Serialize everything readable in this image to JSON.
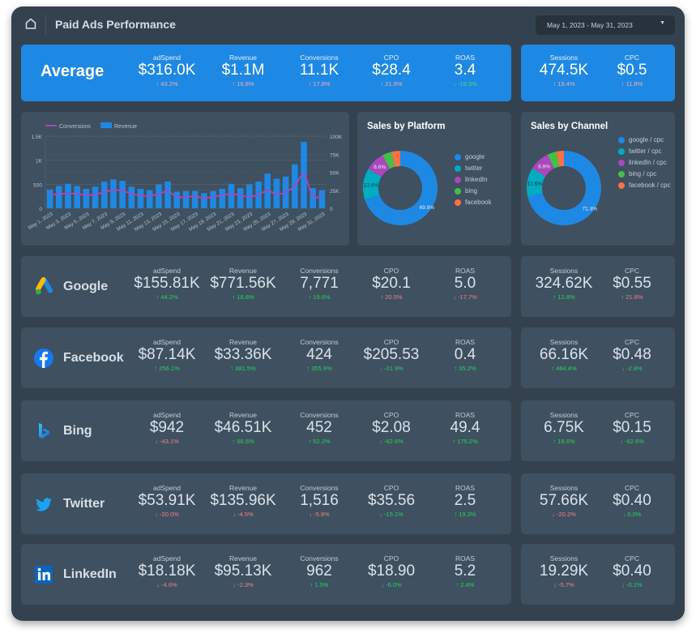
{
  "header": {
    "title": "Paid Ads Performance",
    "date_range": "May 1, 2023 - May 31, 2023",
    "home_icon": "home-icon",
    "dropdown_icon": "caret-down-icon"
  },
  "average": {
    "label": "Average",
    "metrics": [
      {
        "label": "adSpend",
        "value": "$316.0K",
        "change": "43.2%",
        "direction": "up",
        "sentiment": "bad"
      },
      {
        "label": "Revenue",
        "value": "$1.1M",
        "change": "16.8%",
        "direction": "up",
        "sentiment": "bad"
      },
      {
        "label": "Conversions",
        "value": "11.1K",
        "change": "17.8%",
        "direction": "up",
        "sentiment": "bad"
      },
      {
        "label": "CPO",
        "value": "$28.4",
        "change": "21.6%",
        "direction": "up",
        "sentiment": "bad"
      },
      {
        "label": "ROAS",
        "value": "3.4",
        "change": "-18.5%",
        "direction": "down",
        "sentiment": "good"
      }
    ],
    "side_metrics": [
      {
        "label": "Sessions",
        "value": "474.5K",
        "change": "19.4%",
        "direction": "up",
        "sentiment": "bad"
      },
      {
        "label": "CPC",
        "value": "$0.5",
        "change": "11.8%",
        "direction": "up",
        "sentiment": "bad"
      }
    ]
  },
  "platforms": [
    {
      "name": "Google",
      "icon": "google-ads-icon",
      "metrics": [
        {
          "label": "adSpend",
          "value": "$155.81K",
          "change": "44.2%",
          "direction": "up",
          "sentiment": "good"
        },
        {
          "label": "Revenue",
          "value": "$771.56K",
          "change": "18.6%",
          "direction": "up",
          "sentiment": "good"
        },
        {
          "label": "Conversions",
          "value": "7,771",
          "change": "19.6%",
          "direction": "up",
          "sentiment": "good"
        },
        {
          "label": "CPO",
          "value": "$20.1",
          "change": "20.5%",
          "direction": "up",
          "sentiment": "bad"
        },
        {
          "label": "ROAS",
          "value": "5.0",
          "change": "-17.7%",
          "direction": "down",
          "sentiment": "bad"
        }
      ],
      "side_metrics": [
        {
          "label": "Sessions",
          "value": "324.62K",
          "change": "12.8%",
          "direction": "up",
          "sentiment": "good"
        },
        {
          "label": "CPC",
          "value": "$0.55",
          "change": "21.8%",
          "direction": "up",
          "sentiment": "bad"
        }
      ]
    },
    {
      "name": "Facebook",
      "icon": "facebook-icon",
      "metrics": [
        {
          "label": "adSpend",
          "value": "$87.14K",
          "change": "256.1%",
          "direction": "up",
          "sentiment": "good"
        },
        {
          "label": "Revenue",
          "value": "$33.36K",
          "change": "381.5%",
          "direction": "up",
          "sentiment": "good"
        },
        {
          "label": "Conversions",
          "value": "424",
          "change": "355.9%",
          "direction": "up",
          "sentiment": "good"
        },
        {
          "label": "CPO",
          "value": "$205.53",
          "change": "-21.9%",
          "direction": "down",
          "sentiment": "good"
        },
        {
          "label": "ROAS",
          "value": "0.4",
          "change": "35.2%",
          "direction": "up",
          "sentiment": "good"
        }
      ],
      "side_metrics": [
        {
          "label": "Sessions",
          "value": "66.16K",
          "change": "484.4%",
          "direction": "up",
          "sentiment": "good"
        },
        {
          "label": "CPC",
          "value": "$0.48",
          "change": "-2.8%",
          "direction": "down",
          "sentiment": "good"
        }
      ]
    },
    {
      "name": "Bing",
      "icon": "bing-icon",
      "metrics": [
        {
          "label": "adSpend",
          "value": "$942",
          "change": "-43.1%",
          "direction": "down",
          "sentiment": "bad"
        },
        {
          "label": "Revenue",
          "value": "$46.51K",
          "change": "56.5%",
          "direction": "up",
          "sentiment": "good"
        },
        {
          "label": "Conversions",
          "value": "452",
          "change": "52.2%",
          "direction": "up",
          "sentiment": "good"
        },
        {
          "label": "CPO",
          "value": "$2.08",
          "change": "-62.6%",
          "direction": "down",
          "sentiment": "good"
        },
        {
          "label": "ROAS",
          "value": "49.4",
          "change": "175.2%",
          "direction": "up",
          "sentiment": "good"
        }
      ],
      "side_metrics": [
        {
          "label": "Sessions",
          "value": "6.75K",
          "change": "18.6%",
          "direction": "up",
          "sentiment": "good"
        },
        {
          "label": "CPC",
          "value": "$0.15",
          "change": "-62.6%",
          "direction": "down",
          "sentiment": "good"
        }
      ]
    },
    {
      "name": "Twitter",
      "icon": "twitter-icon",
      "metrics": [
        {
          "label": "adSpend",
          "value": "$53.91K",
          "change": "-20.0%",
          "direction": "down",
          "sentiment": "bad"
        },
        {
          "label": "Revenue",
          "value": "$135.96K",
          "change": "-4.5%",
          "direction": "down",
          "sentiment": "bad"
        },
        {
          "label": "Conversions",
          "value": "1,516",
          "change": "-5.8%",
          "direction": "down",
          "sentiment": "bad"
        },
        {
          "label": "CPO",
          "value": "$35.56",
          "change": "-15.1%",
          "direction": "down",
          "sentiment": "good"
        },
        {
          "label": "ROAS",
          "value": "2.5",
          "change": "19.3%",
          "direction": "up",
          "sentiment": "good"
        }
      ],
      "side_metrics": [
        {
          "label": "Sessions",
          "value": "57.66K",
          "change": "-20.2%",
          "direction": "down",
          "sentiment": "bad"
        },
        {
          "label": "CPC",
          "value": "$0.40",
          "change": "0.0%",
          "direction": "down",
          "sentiment": "good"
        }
      ]
    },
    {
      "name": "LinkedIn",
      "icon": "linkedin-icon",
      "metrics": [
        {
          "label": "adSpend",
          "value": "$18.18K",
          "change": "-4.6%",
          "direction": "down",
          "sentiment": "bad"
        },
        {
          "label": "Revenue",
          "value": "$95.13K",
          "change": "-2.3%",
          "direction": "down",
          "sentiment": "bad"
        },
        {
          "label": "Conversions",
          "value": "962",
          "change": "1.5%",
          "direction": "up",
          "sentiment": "good"
        },
        {
          "label": "CPO",
          "value": "$18.90",
          "change": "-6.0%",
          "direction": "down",
          "sentiment": "good"
        },
        {
          "label": "ROAS",
          "value": "5.2",
          "change": "2.4%",
          "direction": "up",
          "sentiment": "good"
        }
      ],
      "side_metrics": [
        {
          "label": "Sessions",
          "value": "19.29K",
          "change": "-5.7%",
          "direction": "down",
          "sentiment": "bad"
        },
        {
          "label": "CPC",
          "value": "$0.40",
          "change": "-0.1%",
          "direction": "down",
          "sentiment": "good"
        }
      ]
    }
  ],
  "colors": {
    "accent_blue": "#1e88e5",
    "conversions_line": "#ab47bc",
    "positive": "#22d65a",
    "negative": "#f0847a",
    "google": "#1e88e5",
    "twitter": "#00acc1",
    "linkedin": "#ab47bc",
    "bing": "#43c04a",
    "facebook": "#ff7043"
  },
  "chart_data": [
    {
      "type": "bar",
      "title": "",
      "legend": [
        "Conversions",
        "Revenue"
      ],
      "legend_position": "top-left",
      "x": [
        "May 1, 2023",
        "May 2, 2023",
        "May 3, 2023",
        "May 4, 2023",
        "May 5, 2023",
        "May 6, 2023",
        "May 7, 2023",
        "May 8, 2023",
        "May 9, 2023",
        "May 10, 2023",
        "May 11, 2023",
        "May 12, 2023",
        "May 13, 2023",
        "May 14, 2023",
        "May 15, 2023",
        "May 16, 2023",
        "May 17, 2023",
        "May 18, 2023",
        "May 19, 2023",
        "May 20, 2023",
        "May 21, 2023",
        "May 22, 2023",
        "May 23, 2023",
        "May 24, 2023",
        "May 25, 2023",
        "May 26, 2023",
        "May 27, 2023",
        "May 28, 2023",
        "May 29, 2023",
        "May 30, 2023",
        "May 31, 2023"
      ],
      "x_tick_labels": [
        "May 1, 2023",
        "May 3, 2023",
        "May 5, 2023",
        "May 7, 2023",
        "May 9, 2023",
        "May 11, 2023",
        "May 13, 2023",
        "May 15, 2023",
        "May 17, 2023",
        "May 19, 2023",
        "May 21, 2023",
        "May 23, 2023",
        "May 25, 2023",
        "May 27, 2023",
        "May 29, 2023",
        "May 31, 2023"
      ],
      "series": [
        {
          "name": "Revenue",
          "type": "bar",
          "axis": "right",
          "values": [
            26000,
            31000,
            34000,
            31000,
            27000,
            30000,
            37000,
            40000,
            38000,
            30000,
            27000,
            25000,
            33000,
            37000,
            23000,
            24000,
            24000,
            21000,
            24000,
            27000,
            34000,
            28000,
            33000,
            37000,
            48000,
            41000,
            44000,
            61000,
            92000,
            28000,
            25000
          ]
        },
        {
          "name": "Conversions",
          "type": "line",
          "axis": "left",
          "values": [
            280,
            300,
            305,
            305,
            275,
            290,
            340,
            380,
            365,
            300,
            270,
            255,
            300,
            350,
            240,
            235,
            250,
            210,
            240,
            270,
            300,
            270,
            240,
            280,
            370,
            290,
            340,
            460,
            700,
            250,
            270
          ]
        }
      ],
      "left_axis": {
        "ylim": [
          0,
          1500
        ],
        "ticks": [
          "0",
          "500",
          "1K",
          "1.5K"
        ]
      },
      "right_axis": {
        "ylim": [
          0,
          100000
        ],
        "ticks": [
          "0",
          "25K",
          "50K",
          "75K",
          "100K"
        ]
      },
      "grid": true
    },
    {
      "type": "pie",
      "title": "Sales by Platform",
      "donut": true,
      "legend_position": "right",
      "slices": [
        {
          "label": "google",
          "value": 69.9,
          "color": "#1e88e5"
        },
        {
          "label": "twitter",
          "value": 13.6,
          "color": "#00acc1"
        },
        {
          "label": "linkedIn",
          "value": 8.6,
          "color": "#ab47bc"
        },
        {
          "label": "bing",
          "value": 4.1,
          "color": "#43c04a"
        },
        {
          "label": "facebook",
          "value": 3.8,
          "color": "#ff7043"
        }
      ],
      "data_labels": [
        "69.9%",
        "13.6%",
        "8.6%"
      ]
    },
    {
      "type": "pie",
      "title": "Sales by Channel",
      "donut": true,
      "legend_position": "right",
      "slices": [
        {
          "label": "google / cpc",
          "value": 71.3,
          "color": "#1e88e5"
        },
        {
          "label": "twitter / cpc",
          "value": 12.6,
          "color": "#00acc1"
        },
        {
          "label": "linkedIn / cpc",
          "value": 8.8,
          "color": "#ab47bc"
        },
        {
          "label": "bing / cpc",
          "value": 4.0,
          "color": "#43c04a"
        },
        {
          "label": "facebook / cpc",
          "value": 3.3,
          "color": "#ff7043"
        }
      ],
      "data_labels": [
        "71.3%",
        "12.6%",
        "8.8%"
      ]
    }
  ]
}
